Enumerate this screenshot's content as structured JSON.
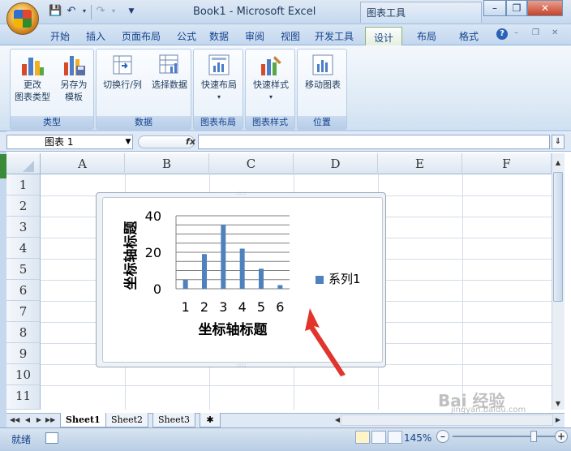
{
  "window": {
    "title": "Book1 - Microsoft Excel",
    "context_tool_label": "图表工具"
  },
  "menu_tabs": [
    "开始",
    "插入",
    "页面布局",
    "公式",
    "数据",
    "审阅",
    "视图",
    "开发工具",
    "设计",
    "布局",
    "格式"
  ],
  "active_tab": "设计",
  "ribbon_groups": [
    {
      "label": "类型",
      "buttons": [
        {
          "label_line1": "更改",
          "label_line2": "图表类型",
          "icon": "change-chart-type-icon"
        },
        {
          "label_line1": "另存为",
          "label_line2": "模板",
          "icon": "save-as-template-icon"
        }
      ]
    },
    {
      "label": "数据",
      "buttons": [
        {
          "label_line1": "切换行/列",
          "label_line2": "",
          "icon": "switch-row-column-icon"
        },
        {
          "label_line1": "选择数据",
          "label_line2": "",
          "icon": "select-data-icon"
        }
      ]
    },
    {
      "label": "图表布局",
      "buttons": [
        {
          "label_line1": "快速布局",
          "label_line2": "▾",
          "icon": "quick-layout-icon"
        }
      ]
    },
    {
      "label": "图表样式",
      "buttons": [
        {
          "label_line1": "快速样式",
          "label_line2": "▾",
          "icon": "quick-styles-icon"
        }
      ]
    },
    {
      "label": "位置",
      "buttons": [
        {
          "label_line1": "移动图表",
          "label_line2": "",
          "icon": "move-chart-icon"
        }
      ]
    }
  ],
  "name_box": {
    "value": "图表 1"
  },
  "formula_bar": {
    "fx_label": "fx",
    "value": ""
  },
  "columns": [
    "A",
    "B",
    "C",
    "D",
    "E",
    "F"
  ],
  "rows": [
    "1",
    "2",
    "3",
    "4",
    "5",
    "6",
    "7",
    "8",
    "9",
    "10",
    "11"
  ],
  "sheets": [
    "Sheet1",
    "Sheet2",
    "Sheet3"
  ],
  "active_sheet": "Sheet1",
  "status": {
    "ready": "就绪",
    "zoom": "145%",
    "zoom_level": 0.79
  },
  "watermark": {
    "line1": "Bai 经验",
    "line2": "jingyan.baidu.com"
  },
  "chart_data": {
    "type": "bar",
    "categories": [
      "1",
      "2",
      "3",
      "4",
      "5",
      "6"
    ],
    "series": [
      {
        "name": "系列1",
        "values": [
          5,
          19,
          35,
          22,
          11,
          2
        ]
      }
    ],
    "xlabel": "坐标轴标题",
    "ylabel": "坐标轴标题",
    "ylim": [
      0,
      40
    ],
    "yticks": [
      0,
      20,
      40
    ],
    "grid": true,
    "legend": "right",
    "bar_color": "#4f81bd"
  },
  "annotation": {
    "type": "red-arrow",
    "color": "#e0342c"
  }
}
